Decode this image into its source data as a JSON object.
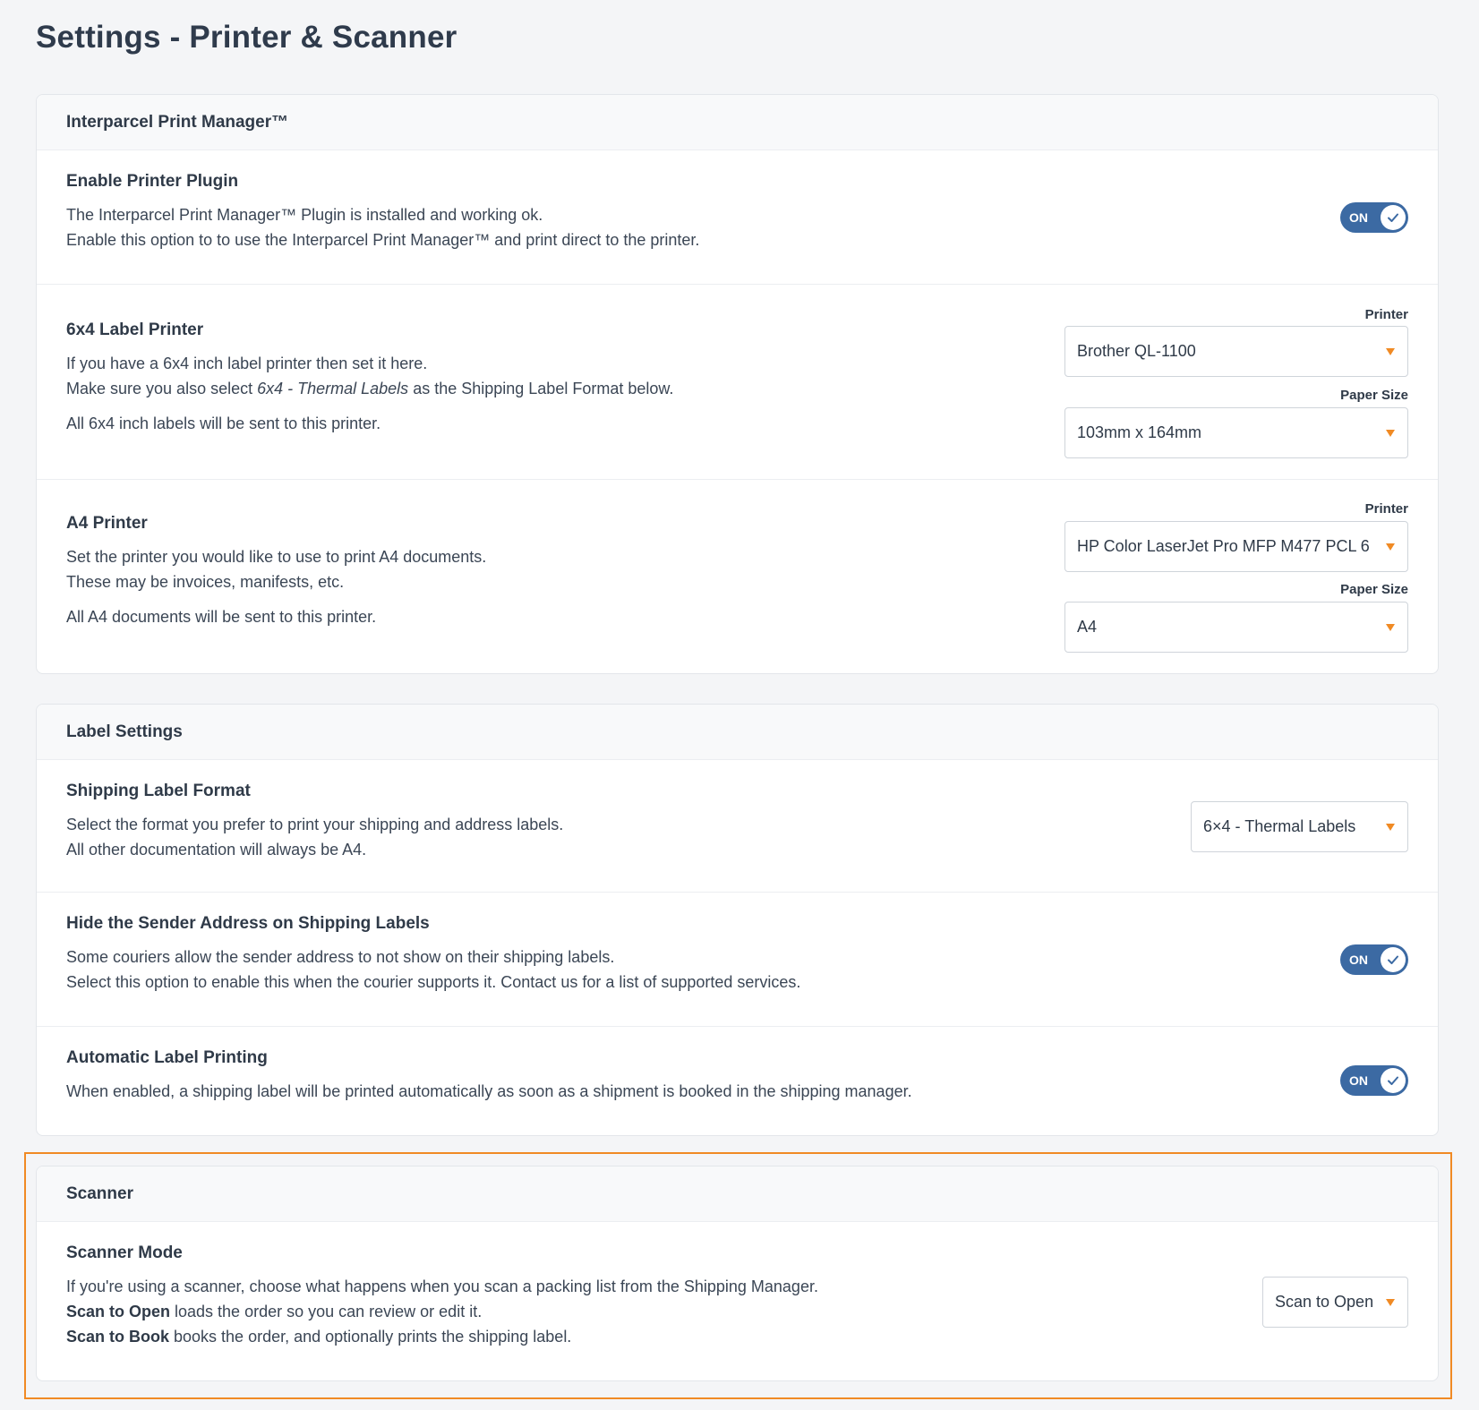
{
  "page": {
    "title": "Settings - Printer & Scanner"
  },
  "print_manager": {
    "header": "Interparcel Print Manager™",
    "enable_plugin": {
      "title": "Enable Printer Plugin",
      "line1": "The Interparcel Print Manager™ Plugin is installed and working ok.",
      "line2": "Enable this option to to use the Interparcel Print Manager™ and print direct to the printer.",
      "toggle": "ON"
    },
    "label_printer": {
      "title": "6x4 Label Printer",
      "line1": "If you have a 6x4 inch label printer then set it here.",
      "line2_pre": "Make sure you also select ",
      "line2_em": "6x4 - Thermal Labels",
      "line2_post": " as the Shipping Label Format below.",
      "line3": "All 6x4 inch labels will be sent to this printer.",
      "printer_label": "Printer",
      "printer_value": "Brother QL-1100",
      "paper_label": "Paper Size",
      "paper_value": "103mm x 164mm"
    },
    "a4_printer": {
      "title": "A4 Printer",
      "line1": "Set the printer you would like to use to print A4 documents.",
      "line2": "These may be invoices, manifests, etc.",
      "line3": "All A4 documents will be sent to this printer.",
      "printer_label": "Printer",
      "printer_value": "HP Color LaserJet Pro MFP M477 PCL 6",
      "paper_label": "Paper Size",
      "paper_value": "A4"
    }
  },
  "label_settings": {
    "header": "Label Settings",
    "format": {
      "title": "Shipping Label Format",
      "line1": "Select the format you prefer to print your shipping and address labels.",
      "line2": "All other documentation will always be A4.",
      "value": "6×4 - Thermal Labels"
    },
    "hide_sender": {
      "title": "Hide the Sender Address on Shipping Labels",
      "line1": "Some couriers allow the sender address to not show on their shipping labels.",
      "line2": "Select this option to enable this when the courier supports it. Contact us for a list of supported services.",
      "toggle": "ON"
    },
    "auto_print": {
      "title": "Automatic Label Printing",
      "line1": "When enabled, a shipping label will be printed automatically as soon as a shipment is booked in the shipping manager.",
      "toggle": "ON"
    }
  },
  "scanner": {
    "header": "Scanner",
    "mode": {
      "title": "Scanner Mode",
      "line1": "If you're using a scanner, choose what happens when you scan a packing list from the Shipping Manager.",
      "line2_bold": "Scan to Open",
      "line2_rest": " loads the order so you can review or edit it.",
      "line3_bold": "Scan to Book",
      "line3_rest": " books the order, and optionally prints the shipping label.",
      "value": "Scan to Open"
    }
  },
  "colors": {
    "toggle_on": "#3c6aa3",
    "accent_orange": "#f08a24",
    "background": "#f4f5f7"
  }
}
